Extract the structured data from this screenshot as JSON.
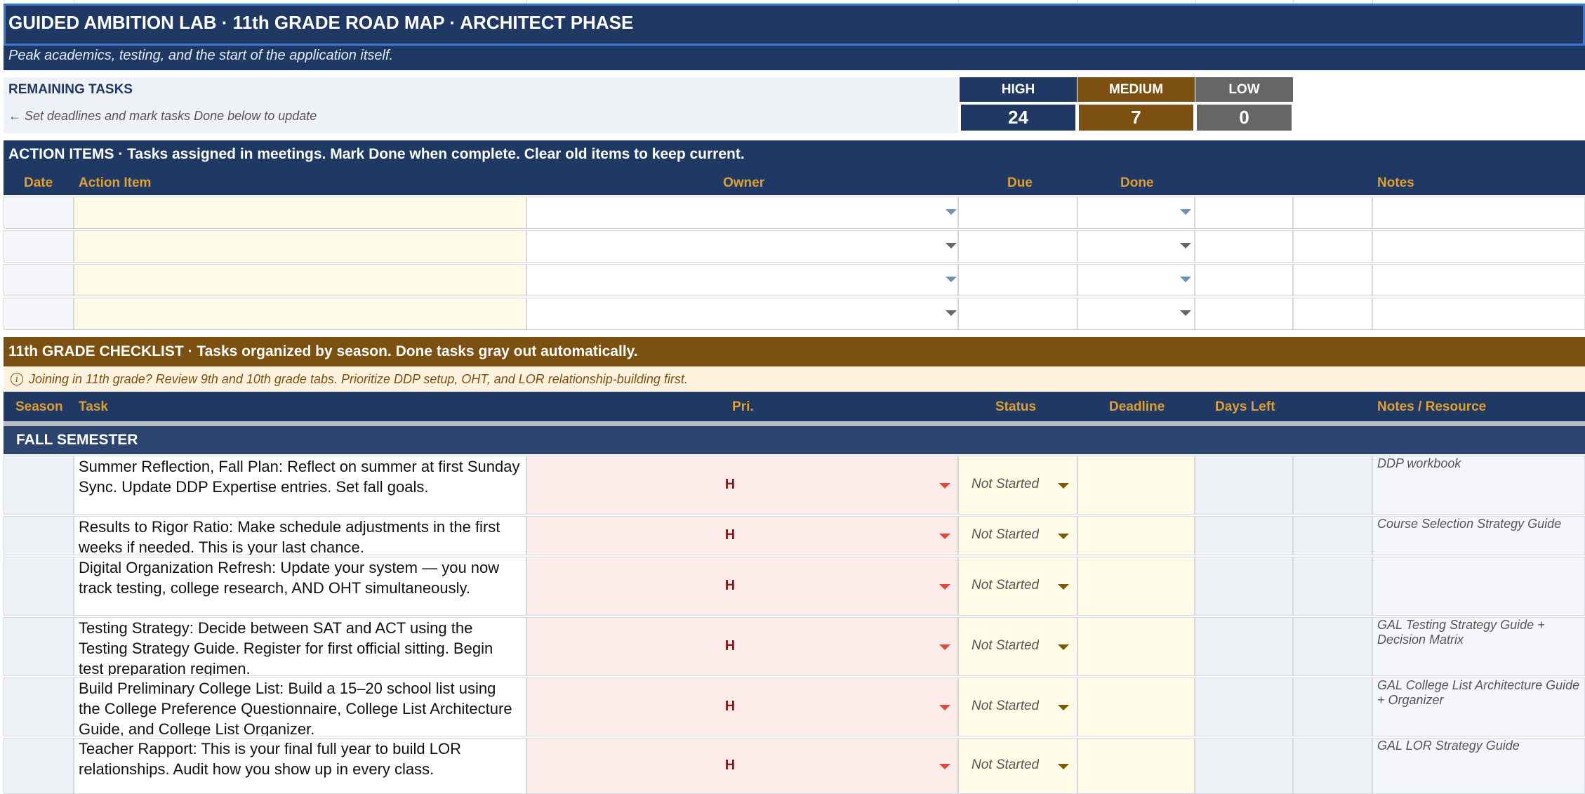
{
  "header": {
    "title": "GUIDED AMBITION LAB  ·  11th GRADE ROAD MAP  ·  ARCHITECT PHASE",
    "subtitle": "Peak academics, testing, and the start of the application itself."
  },
  "remaining": {
    "title": "REMAINING TASKS",
    "note": "← Set deadlines and mark tasks Done below to update",
    "stats": [
      {
        "label": "HIGH",
        "value": "24",
        "head_color": "#1f3864",
        "value_color": "#1f3864"
      },
      {
        "label": "MEDIUM",
        "value": "7",
        "head_color": "#7b5010",
        "value_color": "#7b5010"
      },
      {
        "label": "LOW",
        "value": "0",
        "head_color": "#666666",
        "value_color": "#666666"
      }
    ]
  },
  "action_items": {
    "title": "ACTION ITEMS  ·  Tasks assigned in meetings. Mark Done when complete. Clear old items to keep current.",
    "columns": {
      "date": "Date",
      "action_item": "Action Item",
      "owner": "Owner",
      "due": "Due",
      "done": "Done",
      "notes": "Notes"
    },
    "row_count": 4
  },
  "checklist": {
    "title": "11th GRADE CHECKLIST  ·  Tasks organized by season. Done tasks gray out automatically.",
    "info": "Joining in 11th grade? Review 9th and 10th grade tabs. Prioritize DDP setup, OHT, and LOR relationship-building first.",
    "info_icon": "info-circle-icon",
    "columns": {
      "season": "Season",
      "task": "Task",
      "pri": "Pri.",
      "status": "Status",
      "deadline": "Deadline",
      "days_left": "Days Left",
      "notes": "Notes / Resource"
    },
    "section": "FALL SEMESTER",
    "tasks": [
      {
        "task": "Summer Reflection, Fall Plan: Reflect on summer at first Sunday Sync. Update DDP Expertise entries. Set fall goals.",
        "pri": "H",
        "status": "Not Started",
        "note": "DDP workbook"
      },
      {
        "task": "Results to Rigor Ratio: Make schedule adjustments in the first weeks if needed. This is your last chance.",
        "pri": "H",
        "status": "Not Started",
        "note": "Course Selection Strategy Guide"
      },
      {
        "task": "Digital Organization Refresh: Update your system — you now track testing, college research, AND OHT simultaneously.",
        "pri": "H",
        "status": "Not Started",
        "note": ""
      },
      {
        "task": "Testing Strategy: Decide between SAT and ACT using the Testing Strategy Guide. Register for first official sitting. Begin test preparation regimen.",
        "pri": "H",
        "status": "Not Started",
        "note": "GAL Testing Strategy Guide + Decision Matrix"
      },
      {
        "task": "Build Preliminary College List: Build a 15–20 school list using the College Preference Questionnaire, College List Architecture Guide, and College List Organizer.",
        "pri": "H",
        "status": "Not Started",
        "note": "GAL College List Architecture Guide + Organizer"
      },
      {
        "task": "Teacher Rapport: This is your final full year to build LOR relationships. Audit how you show up in every class.",
        "pri": "H",
        "status": "Not Started",
        "note": "GAL LOR Strategy Guide"
      }
    ]
  },
  "colors": {
    "navy": "#1f3864",
    "brown": "#7b5010",
    "gray": "#666666",
    "gold_text": "#e0a030",
    "pri_red": "#8b1a1a",
    "cream": "#fffbe6",
    "pink": "#fdecea"
  }
}
